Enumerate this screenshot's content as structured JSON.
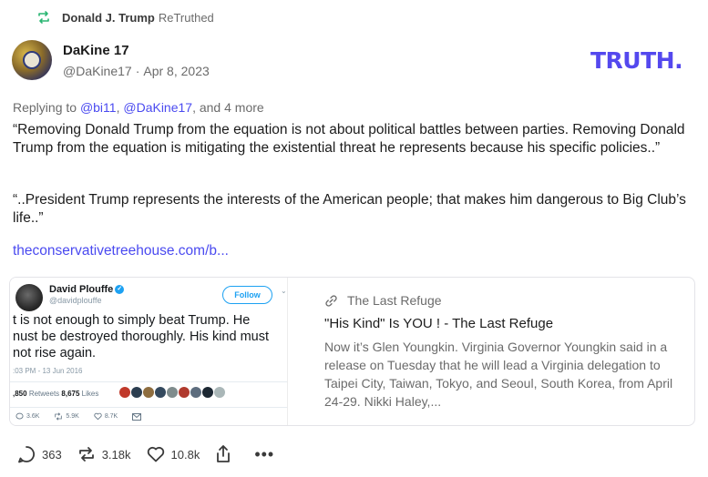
{
  "retruth": {
    "name": "Donald J. Trump",
    "suffix": "ReTruthed",
    "icon": "retruth-icon",
    "color": "#2bb673"
  },
  "post": {
    "author_name": "DaKine 17",
    "author_handle": "@DaKine17",
    "separator": "·",
    "date": "Apr 8, 2023",
    "replying_prefix": "Replying to",
    "mention_1": "@bi11",
    "mention_2": "@DaKine17",
    "replying_suffix": ", and 4 more",
    "paragraph_1": "“Removing Donald Trump from the equation is not about political battles between parties. Removing Donald Trump from the equation is mitigating the existential threat he represents because his specific policies..”",
    "paragraph_2": "“..President Trump represents the interests of the American people; that makes him dangerous to Big Club’s life..”",
    "link": "theconservativetreehouse.com/b..."
  },
  "logo": {
    "text": "TRUTH",
    "dot": ".",
    "color": "#5448ee"
  },
  "card": {
    "source": "The Last Refuge",
    "title": "\"His Kind\" Is YOU ! - The Last Refuge",
    "description": "Now it’s Glen Youngkin.  Virginia Governor Youngkin said in a release on Tuesday that he will lead a Virginia delegation to Taipei City, Taiwan, Tokyo, and Seoul, South Korea, from April 24-29. Nikki Haley,...",
    "tweet": {
      "name": "David Plouffe",
      "verified": "✓",
      "handle": "@davidplouffe",
      "follow": "Follow",
      "text": "t is not enough to simply beat Trump. He\nnust be destroyed thoroughly. His kind must\nnot rise again.",
      "time": ":03 PM - 13 Jun 2016",
      "retweets_count": ",850",
      "retweets_label": "Retweets",
      "likes_count": "8,675",
      "likes_label": "Likes",
      "reply_count": "3.6K",
      "retweet_count": "5.9K",
      "like_count": "8.7K"
    }
  },
  "actions": {
    "replies": "363",
    "retruths": "3.18k",
    "likes": "10.8k",
    "more": "•••"
  }
}
